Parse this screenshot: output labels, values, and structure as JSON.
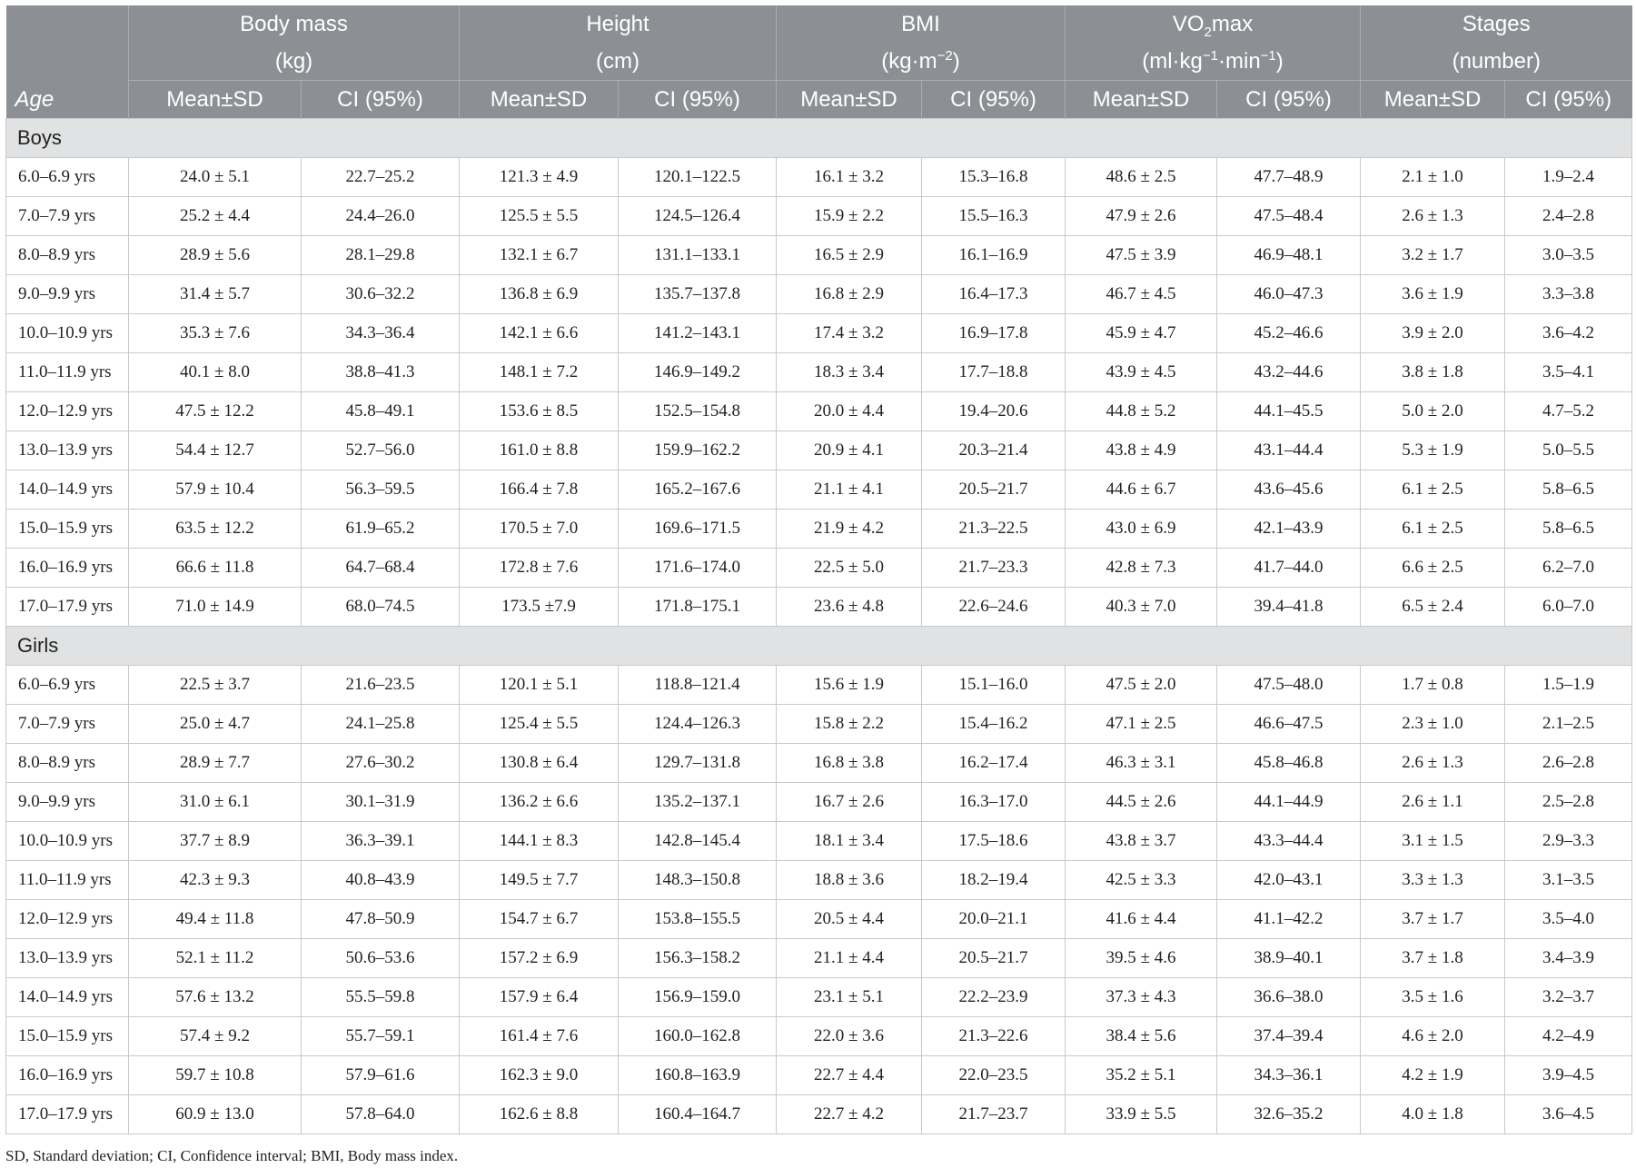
{
  "header": {
    "age_label": "Age",
    "groups": [
      {
        "line1": "Body mass",
        "line2": "(kg)"
      },
      {
        "line1": "Height",
        "line2": "(cm)"
      },
      {
        "line1": "BMI",
        "line2_pre": "(kg·m",
        "line2_sup": "−2",
        "line2_post": ")"
      },
      {
        "line1_pre": "VO",
        "line1_sub": "2",
        "line1_post": "max",
        "line2_a": "(ml·kg",
        "line2_sup1": "−1",
        "line2_b": "·min",
        "line2_sup2": "−1",
        "line2_c": ")"
      },
      {
        "line1": "Stages",
        "line2": "(number)"
      }
    ],
    "sub": [
      "Mean±SD",
      "CI (95%)",
      "Mean±SD",
      "CI (95%)",
      "Mean±SD",
      "CI (95%)",
      "Mean±SD",
      "CI (95%)",
      "Mean±SD",
      "CI (95%)"
    ]
  },
  "sections": [
    {
      "label": "Boys",
      "rows": [
        [
          "6.0–6.9 yrs",
          "24.0 ± 5.1",
          "22.7–25.2",
          "121.3 ± 4.9",
          "120.1–122.5",
          "16.1 ± 3.2",
          "15.3–16.8",
          "48.6 ± 2.5",
          "47.7–48.9",
          "2.1 ± 1.0",
          "1.9–2.4"
        ],
        [
          "7.0–7.9 yrs",
          "25.2 ± 4.4",
          "24.4–26.0",
          "125.5 ± 5.5",
          "124.5–126.4",
          "15.9 ± 2.2",
          "15.5–16.3",
          "47.9 ± 2.6",
          "47.5–48.4",
          "2.6 ± 1.3",
          "2.4–2.8"
        ],
        [
          "8.0–8.9 yrs",
          "28.9 ± 5.6",
          "28.1–29.8",
          "132.1 ± 6.7",
          "131.1–133.1",
          "16.5 ± 2.9",
          "16.1–16.9",
          "47.5 ± 3.9",
          "46.9–48.1",
          "3.2 ± 1.7",
          "3.0–3.5"
        ],
        [
          "9.0–9.9 yrs",
          "31.4 ± 5.7",
          "30.6–32.2",
          "136.8 ± 6.9",
          "135.7–137.8",
          "16.8 ± 2.9",
          "16.4–17.3",
          "46.7 ± 4.5",
          "46.0–47.3",
          "3.6 ± 1.9",
          "3.3–3.8"
        ],
        [
          "10.0–10.9 yrs",
          "35.3 ± 7.6",
          "34.3–36.4",
          "142.1 ± 6.6",
          "141.2–143.1",
          "17.4 ± 3.2",
          "16.9–17.8",
          "45.9 ± 4.7",
          "45.2–46.6",
          "3.9 ± 2.0",
          "3.6–4.2"
        ],
        [
          "11.0–11.9 yrs",
          "40.1 ± 8.0",
          "38.8–41.3",
          "148.1 ± 7.2",
          "146.9–149.2",
          "18.3 ± 3.4",
          "17.7–18.8",
          "43.9 ± 4.5",
          "43.2–44.6",
          "3.8 ± 1.8",
          "3.5–4.1"
        ],
        [
          "12.0–12.9 yrs",
          "47.5 ± 12.2",
          "45.8–49.1",
          "153.6 ± 8.5",
          "152.5–154.8",
          "20.0 ± 4.4",
          "19.4–20.6",
          "44.8 ± 5.2",
          "44.1–45.5",
          "5.0 ± 2.0",
          "4.7–5.2"
        ],
        [
          "13.0–13.9 yrs",
          "54.4 ± 12.7",
          "52.7–56.0",
          "161.0 ± 8.8",
          "159.9–162.2",
          "20.9 ± 4.1",
          "20.3–21.4",
          "43.8 ± 4.9",
          "43.1–44.4",
          "5.3 ± 1.9",
          "5.0–5.5"
        ],
        [
          "14.0–14.9 yrs",
          "57.9 ± 10.4",
          "56.3–59.5",
          "166.4 ± 7.8",
          "165.2–167.6",
          "21.1 ± 4.1",
          "20.5–21.7",
          "44.6 ± 6.7",
          "43.6–45.6",
          "6.1 ± 2.5",
          "5.8–6.5"
        ],
        [
          "15.0–15.9 yrs",
          "63.5 ± 12.2",
          "61.9–65.2",
          "170.5 ± 7.0",
          "169.6–171.5",
          "21.9 ± 4.2",
          "21.3–22.5",
          "43.0 ± 6.9",
          "42.1–43.9",
          "6.1 ± 2.5",
          "5.8–6.5"
        ],
        [
          "16.0–16.9 yrs",
          "66.6 ± 11.8",
          "64.7–68.4",
          "172.8 ± 7.6",
          "171.6–174.0",
          "22.5 ± 5.0",
          "21.7–23.3",
          "42.8 ± 7.3",
          "41.7–44.0",
          "6.6 ± 2.5",
          "6.2–7.0"
        ],
        [
          "17.0–17.9 yrs",
          "71.0 ± 14.9",
          "68.0–74.5",
          "173.5 ±7.9",
          "171.8–175.1",
          "23.6 ± 4.8",
          "22.6–24.6",
          "40.3 ± 7.0",
          "39.4–41.8",
          "6.5 ± 2.4",
          "6.0–7.0"
        ]
      ]
    },
    {
      "label": "Girls",
      "rows": [
        [
          "6.0–6.9 yrs",
          "22.5 ± 3.7",
          "21.6–23.5",
          "120.1 ± 5.1",
          "118.8–121.4",
          "15.6 ± 1.9",
          "15.1–16.0",
          "47.5 ± 2.0",
          "47.5–48.0",
          "1.7 ± 0.8",
          "1.5–1.9"
        ],
        [
          "7.0–7.9 yrs",
          "25.0 ± 4.7",
          "24.1–25.8",
          "125.4 ± 5.5",
          "124.4–126.3",
          "15.8 ± 2.2",
          "15.4–16.2",
          "47.1 ± 2.5",
          "46.6–47.5",
          "2.3 ± 1.0",
          "2.1–2.5"
        ],
        [
          "8.0–8.9 yrs",
          "28.9 ± 7.7",
          "27.6–30.2",
          "130.8 ± 6.4",
          "129.7–131.8",
          "16.8 ± 3.8",
          "16.2–17.4",
          "46.3 ± 3.1",
          "45.8–46.8",
          "2.6 ± 1.3",
          "2.6–2.8"
        ],
        [
          "9.0–9.9 yrs",
          "31.0 ± 6.1",
          "30.1–31.9",
          "136.2 ± 6.6",
          "135.2–137.1",
          "16.7 ± 2.6",
          "16.3–17.0",
          "44.5 ± 2.6",
          "44.1–44.9",
          "2.6 ± 1.1",
          "2.5–2.8"
        ],
        [
          "10.0–10.9 yrs",
          "37.7 ± 8.9",
          "36.3–39.1",
          "144.1 ± 8.3",
          "142.8–145.4",
          "18.1 ± 3.4",
          "17.5–18.6",
          "43.8 ± 3.7",
          "43.3–44.4",
          "3.1 ± 1.5",
          "2.9–3.3"
        ],
        [
          "11.0–11.9 yrs",
          "42.3 ± 9.3",
          "40.8–43.9",
          "149.5 ± 7.7",
          "148.3–150.8",
          "18.8 ± 3.6",
          "18.2–19.4",
          "42.5 ± 3.3",
          "42.0–43.1",
          "3.3 ± 1.3",
          "3.1–3.5"
        ],
        [
          "12.0–12.9 yrs",
          "49.4 ± 11.8",
          "47.8–50.9",
          "154.7 ± 6.7",
          "153.8–155.5",
          "20.5 ± 4.4",
          "20.0–21.1",
          "41.6 ± 4.4",
          "41.1–42.2",
          "3.7 ± 1.7",
          "3.5–4.0"
        ],
        [
          "13.0–13.9 yrs",
          "52.1 ± 11.2",
          "50.6–53.6",
          "157.2 ± 6.9",
          "156.3–158.2",
          "21.1 ± 4.4",
          "20.5–21.7",
          "39.5 ± 4.6",
          "38.9–40.1",
          "3.7 ± 1.8",
          "3.4–3.9"
        ],
        [
          "14.0–14.9 yrs",
          "57.6 ± 13.2",
          "55.5–59.8",
          "157.9 ± 6.4",
          "156.9–159.0",
          "23.1 ± 5.1",
          "22.2–23.9",
          "37.3 ± 4.3",
          "36.6–38.0",
          "3.5 ± 1.6",
          "3.2–3.7"
        ],
        [
          "15.0–15.9 yrs",
          "57.4 ± 9.2",
          "55.7–59.1",
          "161.4 ± 7.6",
          "160.0–162.8",
          "22.0 ± 3.6",
          "21.3–22.6",
          "38.4 ± 5.6",
          "37.4–39.4",
          "4.6 ± 2.0",
          "4.2–4.9"
        ],
        [
          "16.0–16.9 yrs",
          "59.7 ± 10.8",
          "57.9–61.6",
          "162.3 ± 9.0",
          "160.8–163.9",
          "22.7 ± 4.4",
          "22.0–23.5",
          "35.2 ± 5.1",
          "34.3–36.1",
          "4.2 ± 1.9",
          "3.9–4.5"
        ],
        [
          "17.0–17.9 yrs",
          "60.9 ± 13.0",
          "57.8–64.0",
          "162.6 ± 8.8",
          "160.4–164.7",
          "22.7 ± 4.2",
          "21.7–23.7",
          "33.9 ± 5.5",
          "32.6–35.2",
          "4.0 ± 1.8",
          "3.6–4.5"
        ]
      ]
    }
  ],
  "footnote": "SD, Standard deviation; CI, Confidence interval; BMI, Body mass index."
}
